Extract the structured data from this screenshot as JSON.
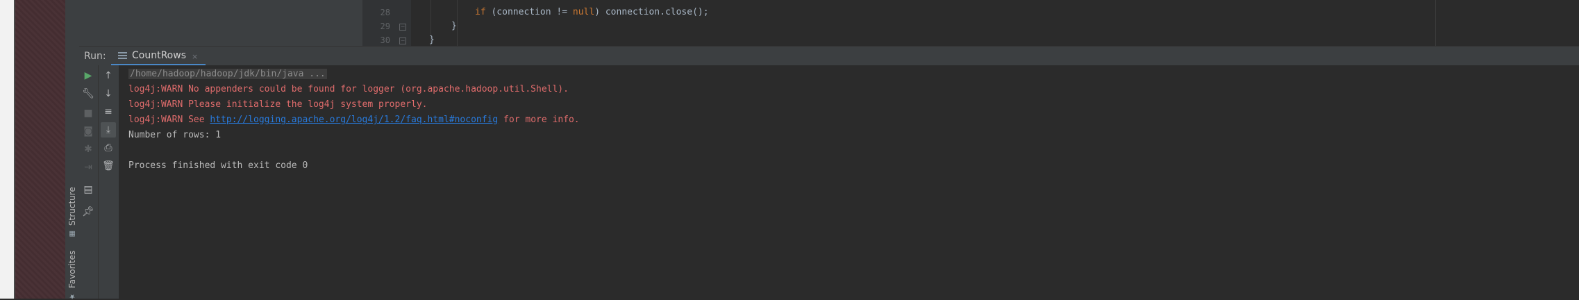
{
  "sidebar": {
    "structure_label": "Structure",
    "favorites_label": "Favorites"
  },
  "editor": {
    "lines": [
      {
        "number": "28",
        "code_prefix": "if",
        "code_rest": " (connection != ",
        "code_kw2": "null",
        "code_tail": ") connection.close();"
      },
      {
        "number": "29",
        "code": "}"
      },
      {
        "number": "30",
        "code": "}"
      }
    ]
  },
  "run_window": {
    "label": "Run:",
    "tab_label": "CountRows",
    "close_glyph": "×"
  },
  "console": {
    "command": "/home/hadoop/hadoop/jdk/bin/java ...",
    "warn1": "log4j:WARN No appenders could be found for logger (org.apache.hadoop.util.Shell).",
    "warn2": "log4j:WARN Please initialize the log4j system properly.",
    "warn3_prefix": "log4j:WARN See ",
    "warn3_link": "http://logging.apache.org/log4j/1.2/faq.html#noconfig",
    "warn3_suffix": " for more info.",
    "rows_line": "Number of rows: 1",
    "finished_line": "Process finished with exit code 0"
  },
  "colors": {
    "accent_tab": "#4a88c7",
    "warn_text": "#e06c6c",
    "link_text": "#287bde",
    "run_green": "#59a869"
  }
}
